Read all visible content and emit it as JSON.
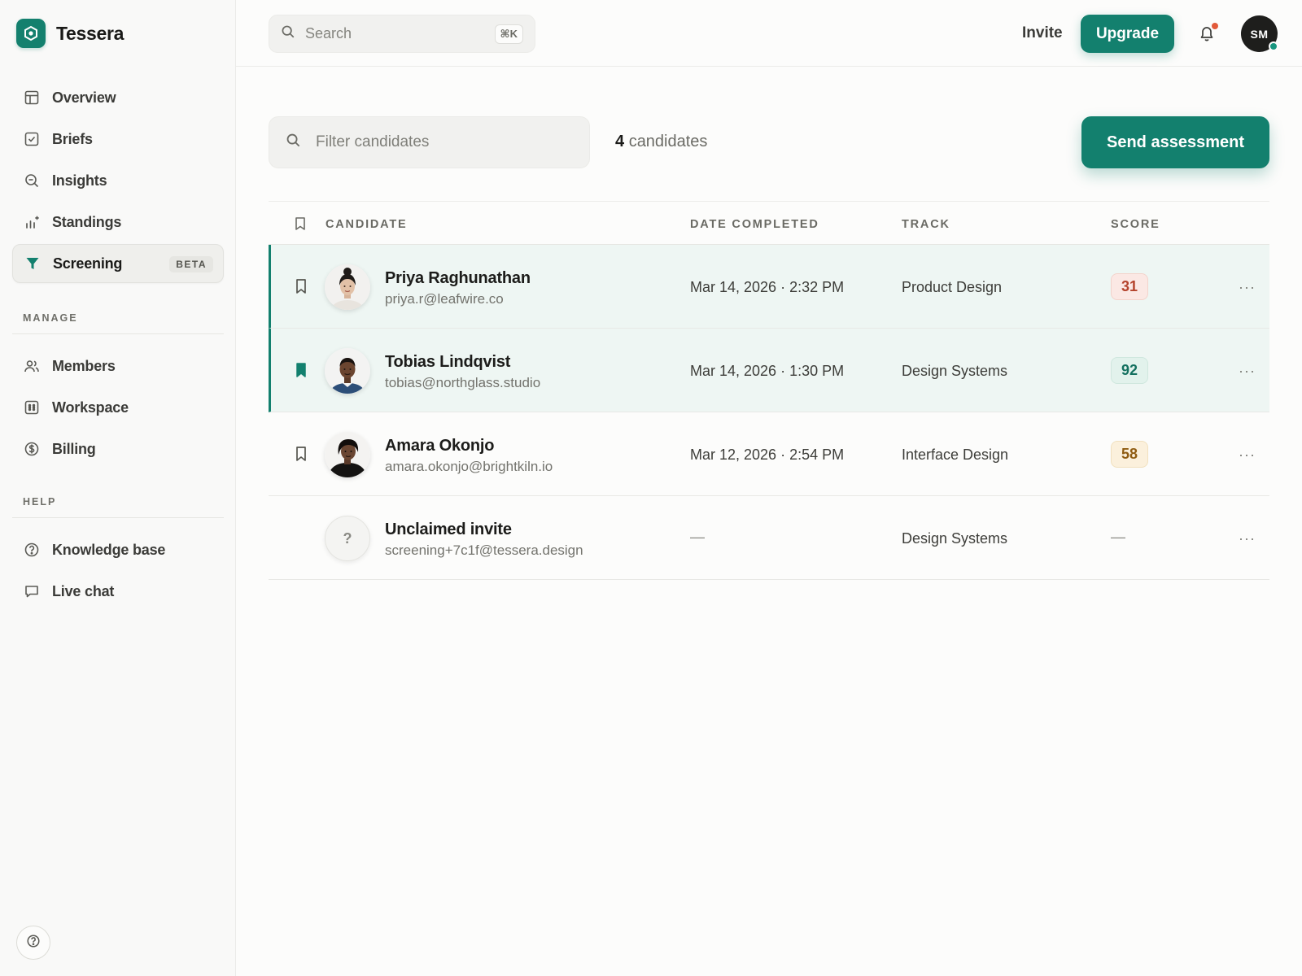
{
  "brand": {
    "name": "Tessera"
  },
  "colors": {
    "accent": "#13806e",
    "score_low": "#b4432c",
    "score_high": "#13705f",
    "score_mid": "#8f5c12"
  },
  "sidebar": {
    "primary": [
      {
        "label": "Overview",
        "icon": "layout-icon"
      },
      {
        "label": "Briefs",
        "icon": "checkbox-icon"
      },
      {
        "label": "Insights",
        "icon": "search-insight-icon"
      },
      {
        "label": "Standings",
        "icon": "bar-chart-icon"
      },
      {
        "label": "Screening",
        "icon": "funnel-icon",
        "badge": "BETA",
        "active": true
      }
    ],
    "manage_label": "MANAGE",
    "manage": [
      {
        "label": "Members",
        "icon": "users-icon"
      },
      {
        "label": "Workspace",
        "icon": "grid-icon"
      },
      {
        "label": "Billing",
        "icon": "dollar-coin-icon"
      }
    ],
    "help_label": "HELP",
    "help": [
      {
        "label": "Knowledge base",
        "icon": "help-circle-icon"
      },
      {
        "label": "Live chat",
        "icon": "chat-icon"
      }
    ]
  },
  "topbar": {
    "search_placeholder": "Search",
    "search_shortcut": "⌘K",
    "invite_label": "Invite",
    "upgrade_label": "Upgrade",
    "user_initials": "SM"
  },
  "main": {
    "filter_placeholder": "Filter candidates",
    "count_number": "4",
    "count_label": "candidates",
    "send_label": "Send assessment",
    "columns": [
      "CANDIDATE",
      "DATE COMPLETED",
      "TRACK",
      "SCORE"
    ],
    "rows": [
      {
        "name": "Priya Raghunathan",
        "email": "priya.r@leafwire.co",
        "date": "Mar 14, 2026 · 2:32 PM",
        "track": "Product Design",
        "score": "31",
        "bookmarked": false,
        "selected": true
      },
      {
        "name": "Tobias Lindqvist",
        "email": "tobias@northglass.studio",
        "date": "Mar 14, 2026 · 1:30 PM",
        "track": "Design Systems",
        "score": "92",
        "bookmarked": true,
        "selected": true
      },
      {
        "name": "Amara Okonjo",
        "email": "amara.okonjo@brightkiln.io",
        "date": "Mar 12, 2026 · 2:54 PM",
        "track": "Interface Design",
        "score": "58",
        "bookmarked": false,
        "selected": false
      },
      {
        "name": "Unclaimed invite",
        "email": "screening+7c1f@tessera.design",
        "date": "—",
        "track": "Design Systems",
        "score": "—",
        "unknown_avatar": "?",
        "selected": false
      }
    ],
    "more_glyph": "···"
  }
}
